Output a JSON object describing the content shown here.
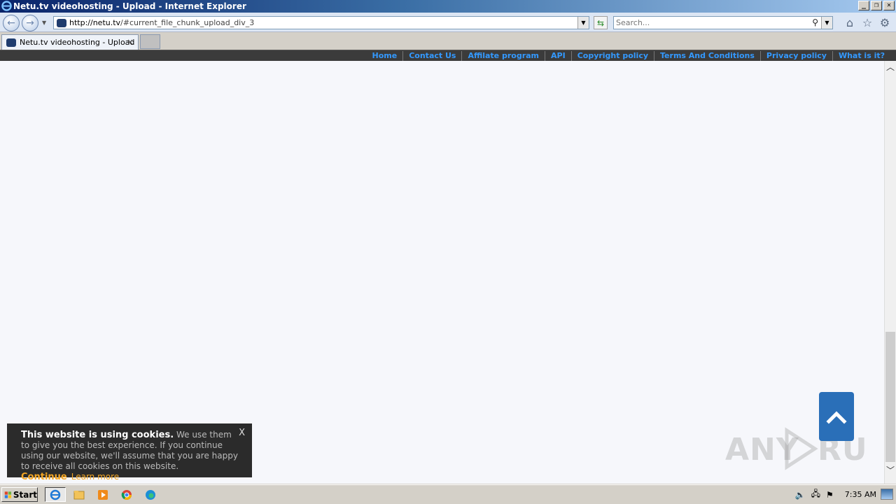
{
  "window": {
    "title": "Netu.tv videohosting - Upload - Internet Explorer",
    "controls": [
      "minimize",
      "restore",
      "close"
    ]
  },
  "toolbar": {
    "url_host": "http://netu.tv",
    "url_path": "/#current_file_chunk_upload_div_3",
    "search_placeholder": "Search..."
  },
  "tabs": [
    {
      "label": "Netu.tv videohosting - Upload",
      "close": "×"
    }
  ],
  "site_nav": {
    "items": [
      "Home",
      "Contact Us",
      "Affilate program",
      "API",
      "Copyright policy",
      "Terms And Conditions",
      "Privacy policy",
      "What is it?"
    ]
  },
  "cookie_banner": {
    "title": "This website is using cookies.",
    "body": " We use them to give you the best experience. If you continue using our website, we'll assume that you are happy to receive all cookies on this website.",
    "continue": "Continue",
    "learn_more": "Learn more",
    "close": "X"
  },
  "watermark": "ANY RUN",
  "taskbar": {
    "start": "Start",
    "clock": "7:35 AM"
  },
  "colors": {
    "nav_link": "#3399ff",
    "cookie_accent": "#f5a623",
    "scroll_top": "#2a6fb8"
  }
}
